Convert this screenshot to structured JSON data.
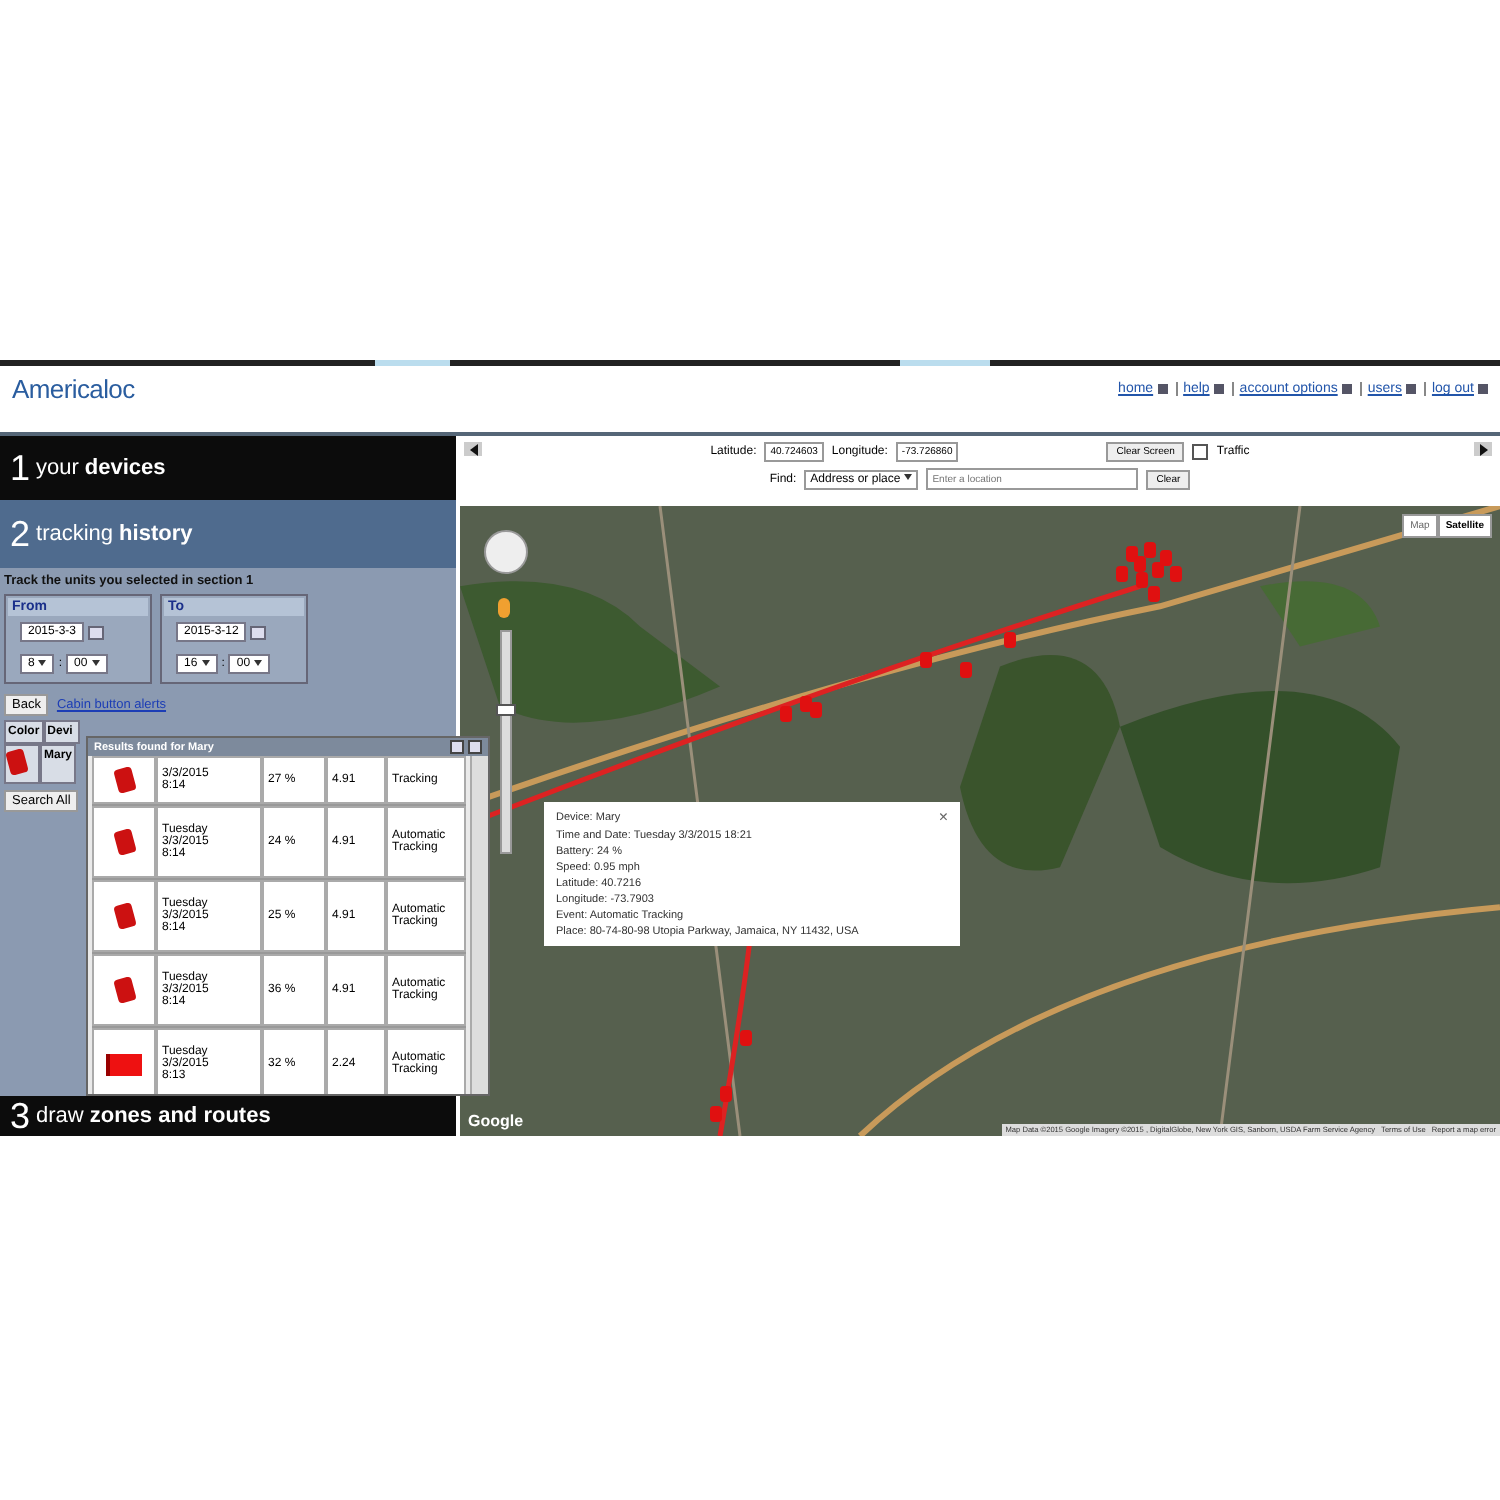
{
  "header": {
    "logo": "Americaloc",
    "nav": [
      "home",
      "help",
      "account options",
      "users",
      "log out"
    ]
  },
  "sections": [
    {
      "number": "1",
      "light": "your",
      "bold": "devices",
      "kind": "dark"
    },
    {
      "number": "2",
      "light": "tracking",
      "bold": "history",
      "kind": "blue"
    }
  ],
  "history": {
    "instruction": "Track the units you selected in section 1",
    "from": {
      "label": "From",
      "date": "2015-3-3",
      "hour": "8",
      "minute": "00"
    },
    "to": {
      "label": "To",
      "date": "2015-3-12",
      "hour": "16",
      "minute": "00"
    },
    "time_separator": ":",
    "back": "Back",
    "link": "Cabin button alerts",
    "columns": [
      "Color",
      "Devi"
    ],
    "device": "Mary",
    "search_all": "Search All"
  },
  "results": {
    "title": "Results found for Mary",
    "rows": [
      {
        "kind": "phone",
        "lines": [
          "3/3/2015",
          "8:14"
        ],
        "battery": "27 %",
        "speed": "4.91",
        "event": [
          "Tracking"
        ]
      },
      {
        "kind": "phone",
        "lines": [
          "Tuesday",
          "3/3/2015",
          "8:14"
        ],
        "battery": "24 %",
        "speed": "4.91",
        "event": [
          "Automatic",
          "Tracking"
        ]
      },
      {
        "kind": "phone",
        "lines": [
          "Tuesday",
          "3/3/2015",
          "8:14"
        ],
        "battery": "25 %",
        "speed": "4.91",
        "event": [
          "Automatic",
          "Tracking"
        ]
      },
      {
        "kind": "phone",
        "lines": [
          "Tuesday",
          "3/3/2015",
          "8:14"
        ],
        "battery": "36 %",
        "speed": "4.91",
        "event": [
          "Automatic",
          "Tracking"
        ]
      },
      {
        "kind": "flag",
        "lines": [
          "Tuesday",
          "3/3/2015",
          "8:13"
        ],
        "battery": "32 %",
        "speed": "2.24",
        "event": [
          "Automatic",
          "Tracking"
        ]
      }
    ]
  },
  "section3": {
    "number": "3",
    "light": "draw",
    "bold": "zones and routes"
  },
  "map_controls": {
    "latitude_label": "Latitude:",
    "latitude": "40.724603",
    "longitude_label": "Longitude:",
    "longitude": "-73.726860",
    "clear_screen": "Clear Screen",
    "traffic": {
      "label": "Traffic",
      "checked": false
    },
    "find_label": "Find:",
    "find_type": "Address or place",
    "placeholder": "Enter a location",
    "clear": "Clear"
  },
  "map": {
    "types": [
      {
        "label": "Map",
        "selected": false
      },
      {
        "label": "Satellite",
        "selected": true
      }
    ],
    "zoom": {
      "level": 0.62
    },
    "info": {
      "close": "×",
      "lines": [
        "Device: Mary",
        "Time and Date: Tuesday 3/3/2015 18:21",
        "Battery: 24 %",
        "Speed: 0.95 mph",
        "Latitude: 40.7216",
        "Longitude: -73.7903",
        "Event: Automatic Tracking",
        "Place: 80-74-80-98 Utopia Parkway, Jamaica, NY 11432, USA"
      ]
    },
    "google": "Google",
    "attribution": "Map Data ©2015 Google Imagery ©2015 , DigitalGlobe, New York GIS, Sanborn, USDA Farm Service Agency",
    "terms": "Terms of Use",
    "report": "Report a map error"
  }
}
